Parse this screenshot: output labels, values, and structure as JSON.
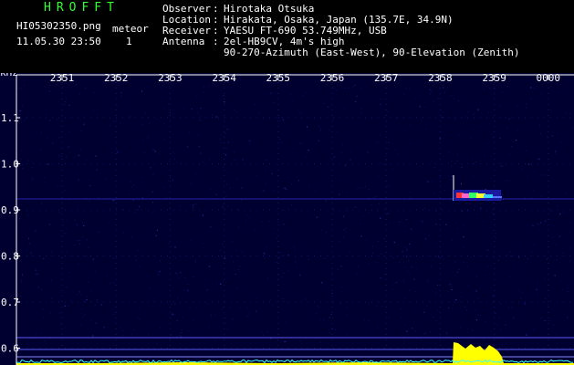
{
  "header": {
    "brand": "HROFFT",
    "filename": "HI05302350.png",
    "timestamp": "11.05.30 23:50",
    "meteor_label": "meteor",
    "meteor_count": "1",
    "info": [
      {
        "key": "Observer",
        "value": "Hirotaka Otsuka"
      },
      {
        "key": "Location",
        "value": "Hirakata, Osaka, Japan (135.7E, 34.9N)"
      },
      {
        "key": "Receiver",
        "value": "YAESU FT-690 53.749MHz, USB"
      },
      {
        "key": "Antenna",
        "value": "2el-HB9CV, 4m's high"
      },
      {
        "key": "",
        "value": "90-270-Azimuth (East-West), 90-Elevation (Zenith)"
      }
    ],
    "colors": {
      "brand": "#33ff33",
      "text": "#ffffff"
    }
  },
  "axes": {
    "unit_label": "kHz",
    "time_ticks": [
      "2351",
      "2352",
      "2353",
      "2354",
      "2355",
      "2356",
      "2357",
      "2358",
      "2359",
      "0000"
    ],
    "freq_ticks": [
      "1.1",
      "1.0",
      "0.9",
      "0.8",
      "0.7",
      "0.6"
    ],
    "colors": {
      "axis": "#ffffff",
      "background": "#000033",
      "grid": "#1a1a80",
      "ref_line": "#5a5aff",
      "noise": "#33ffff",
      "echo": "#ffff00"
    }
  }
}
